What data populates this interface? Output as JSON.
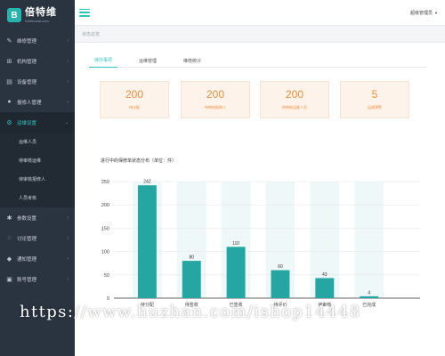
{
  "brand": {
    "name": "倍特维",
    "sub": "Vrbetmeal.com"
  },
  "sidebar": {
    "items": [
      {
        "label": "维修管理",
        "icon": "wrench-icon"
      },
      {
        "label": "机构管理",
        "icon": "sitemap-icon"
      },
      {
        "label": "设备管理",
        "icon": "device-icon"
      },
      {
        "label": "报修人管理",
        "icon": "person-icon"
      },
      {
        "label": "运维设置",
        "icon": "gear-icon",
        "active": true
      },
      {
        "label": "参数设置",
        "icon": "settings-icon"
      },
      {
        "label": "讨论管理",
        "icon": "chat-icon"
      },
      {
        "label": "通知管理",
        "icon": "bell-icon"
      },
      {
        "label": "账号管理",
        "icon": "account-icon"
      }
    ],
    "subitems": [
      "运维人员",
      "待审核运维",
      "待审核报修人",
      "人员考核"
    ]
  },
  "header": {
    "user": "超级管理员"
  },
  "breadcrumb": "状态总览",
  "tabs": [
    "待办事项",
    "运维管理",
    "维修统计"
  ],
  "cards": [
    {
      "value": "200",
      "label": "待分配"
    },
    {
      "value": "200",
      "label": "待审核报修人"
    },
    {
      "value": "200",
      "label": "待审核运维人员"
    },
    {
      "value": "5",
      "label": "运维预警"
    }
  ],
  "chart_title": "进行中的保修单状态分布（单位：件）",
  "chart_data": {
    "type": "bar",
    "categories": [
      "待分配",
      "待签收",
      "已签收",
      "待评价",
      "待审核",
      "已完成"
    ],
    "values": [
      242,
      80,
      110,
      60,
      43,
      4
    ],
    "ylim": [
      0,
      250
    ],
    "yticks": [
      0,
      50,
      100,
      150,
      200,
      250
    ],
    "grid": true,
    "colors": {
      "bar": "#26a6a3",
      "band": "#eef8f9"
    }
  },
  "watermark": "https://www.huzhan.com/ishop14448"
}
